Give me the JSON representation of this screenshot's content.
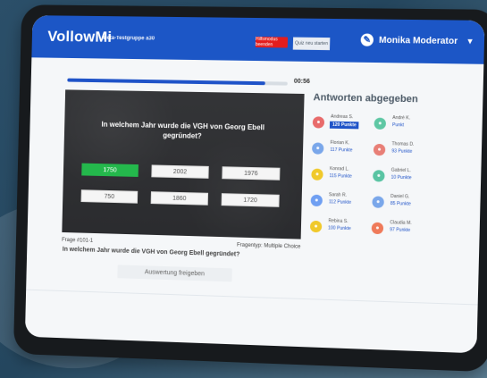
{
  "header": {
    "brand": "VollowMi",
    "group": "Beta-Testgruppe a30",
    "red_button": "Hilfsmodus beenden",
    "light_button": "Quiz neu starten",
    "user": "Monika Moderator"
  },
  "quiz": {
    "timer": "00:56",
    "progress": 0.9,
    "question": "In welchem Jahr wurde die VGH von Georg Ebell gegründet?",
    "answers": [
      "1750",
      "2002",
      "1976",
      "750",
      "1860",
      "1720"
    ],
    "correct_answer": "1750",
    "question_number": "Frage #101-1",
    "question_type": "Fragentyp: Multiple Choice",
    "submit_button": "Auswertung freigeben"
  },
  "participants_panel": {
    "title": "Antworten abgegeben",
    "participants": [
      {
        "name": "Andreas S.",
        "points": "120 Punkte",
        "color": "#e86b6b",
        "highlight": true
      },
      {
        "name": "André K.",
        "points": "Punkt",
        "color": "#5ec7a4",
        "highlight": false
      },
      {
        "name": "Florian K.",
        "points": "117 Punkte",
        "color": "#7aa7ea",
        "highlight": false
      },
      {
        "name": "Thomas D.",
        "points": "93 Punkte",
        "color": "#e87f77",
        "highlight": false
      },
      {
        "name": "Konrad L.",
        "points": "115 Punkte",
        "color": "#f0c92b",
        "highlight": false
      },
      {
        "name": "Gabriel L.",
        "points": "10 Punkte",
        "color": "#59c4a3",
        "highlight": false
      },
      {
        "name": "Sarah R.",
        "points": "112 Punkte",
        "color": "#6f9ff2",
        "highlight": false
      },
      {
        "name": "Daniel G.",
        "points": "85 Punkte",
        "color": "#7aa7ea",
        "highlight": false
      },
      {
        "name": "Rebina S.",
        "points": "100 Punkte",
        "color": "#f0c92b",
        "highlight": false
      },
      {
        "name": "Claudia M.",
        "points": "97 Punkte",
        "color": "#ef7a5a",
        "highlight": false
      }
    ]
  }
}
